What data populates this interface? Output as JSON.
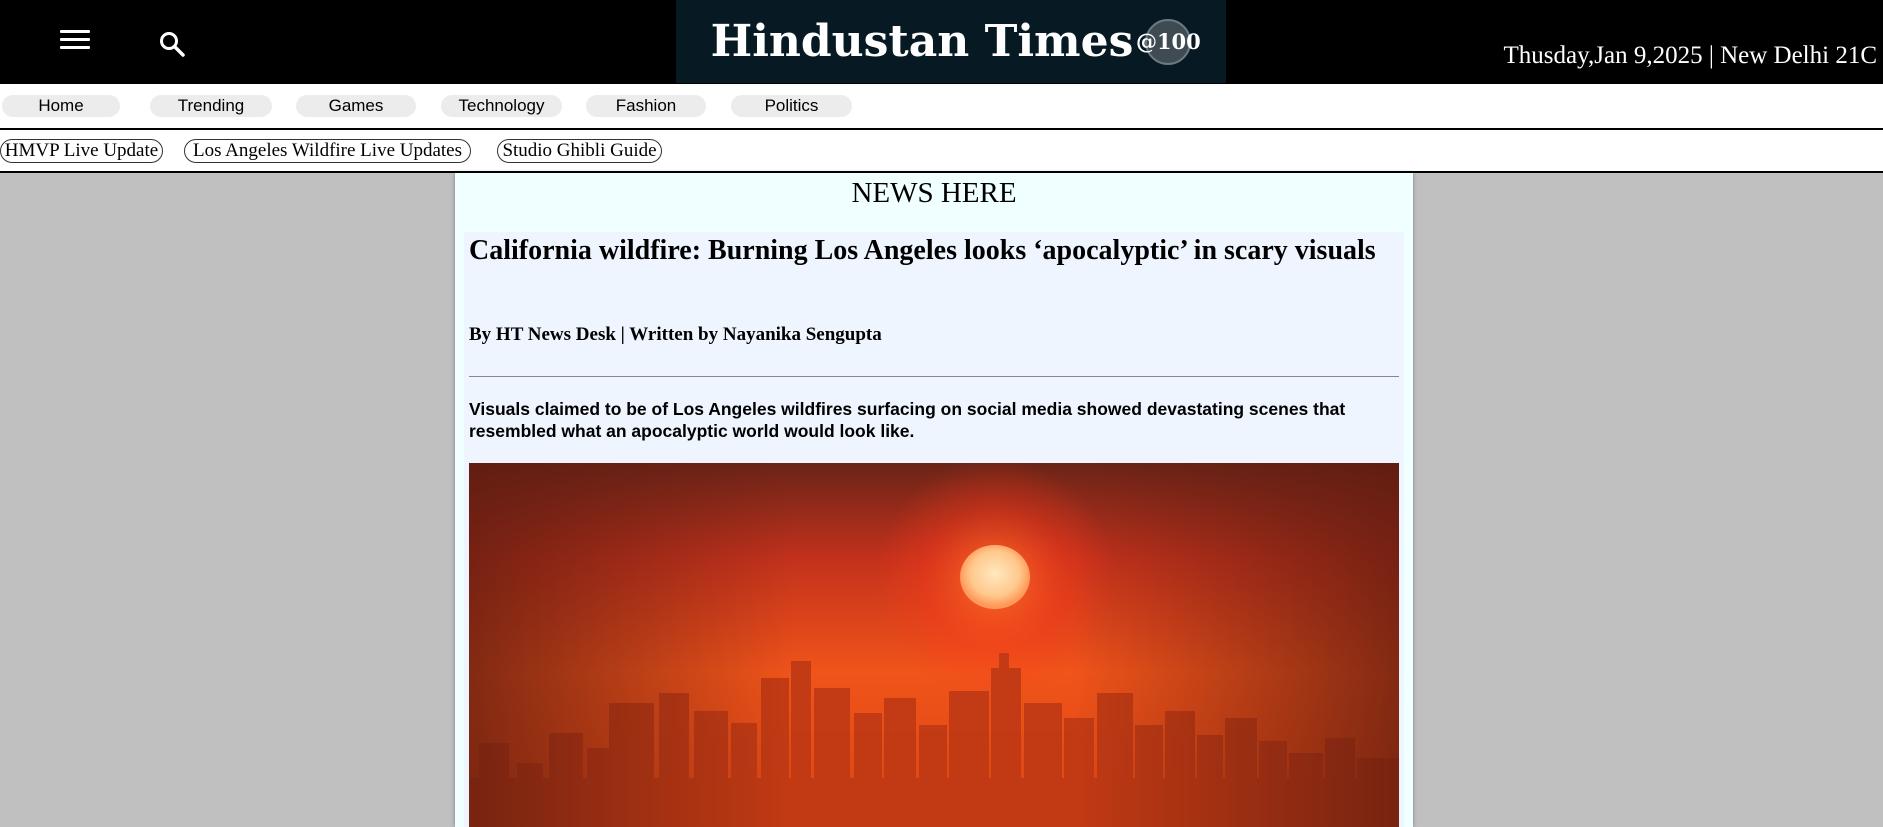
{
  "header": {
    "menu_icon": "hamburger-menu-icon",
    "search_icon": "search-icon",
    "logo_text": "Hindustan Times",
    "logo_seal_text": "@100",
    "dateline": "Thusday,Jan 9,2025 | New Delhi 21C",
    "background": "#000000",
    "logo_background": "#071a24"
  },
  "nav": {
    "items": [
      {
        "label": "Home"
      },
      {
        "label": "Trending"
      },
      {
        "label": "Games"
      },
      {
        "label": "Technology"
      },
      {
        "label": "Fashion"
      },
      {
        "label": "Politics"
      }
    ]
  },
  "topics": {
    "items": [
      {
        "label": "HMVP Live Update"
      },
      {
        "label": "Los Angeles Wildfire Live Updates"
      },
      {
        "label": "Studio Ghibli Guide"
      }
    ]
  },
  "main": {
    "section_title": "NEWS HERE",
    "article": {
      "headline": "California wildfire: Burning Los Angeles looks ‘apocalyptic’ in scary visuals",
      "byline": "By HT News Desk | Written by Nayanika Sengupta",
      "summary": "Visuals claimed to be of Los Angeles wildfires surfacing on social media showed devastating scenes that resembled what an apocalyptic world would look like."
    }
  }
}
